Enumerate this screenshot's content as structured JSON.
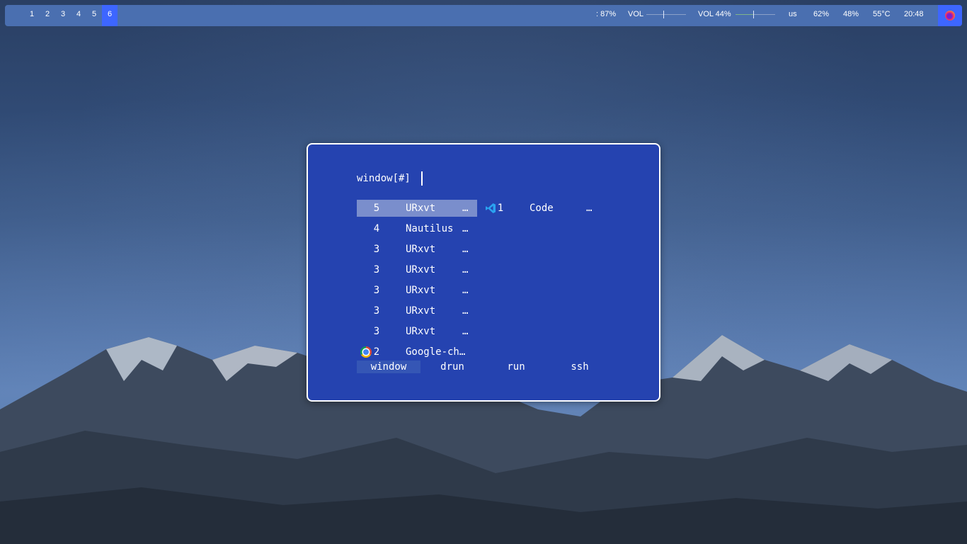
{
  "bar": {
    "workspaces": [
      "1",
      "2",
      "3",
      "4",
      "5",
      "6"
    ],
    "active_workspace": "6",
    "battery": ": 87%",
    "vol_a_label": "VOL",
    "vol_b_label": "VOL 44%",
    "vol_b_level": 0.44,
    "keyboard_layout": "us",
    "cpu": "62%",
    "memory": "48%",
    "temperature": "55°C",
    "clock": "20:48",
    "tray_icon": "firefox-icon"
  },
  "rofi": {
    "prompt": "window[#]",
    "entries_col1": [
      {
        "num": "5",
        "name": "URxvt",
        "ellipsis": "…",
        "icon": null,
        "selected": true
      },
      {
        "num": "4",
        "name": "Nautilus",
        "ellipsis": "…",
        "icon": null,
        "selected": false
      },
      {
        "num": "3",
        "name": "URxvt",
        "ellipsis": "…",
        "icon": null,
        "selected": false
      },
      {
        "num": "3",
        "name": "URxvt",
        "ellipsis": "…",
        "icon": null,
        "selected": false
      },
      {
        "num": "3",
        "name": "URxvt",
        "ellipsis": "…",
        "icon": null,
        "selected": false
      },
      {
        "num": "3",
        "name": "URxvt",
        "ellipsis": "…",
        "icon": null,
        "selected": false
      },
      {
        "num": "3",
        "name": "URxvt",
        "ellipsis": "…",
        "icon": null,
        "selected": false
      },
      {
        "num": "2",
        "name": "Google-ch…",
        "ellipsis": "",
        "icon": "chrome-icon",
        "selected": false
      }
    ],
    "entries_col2": [
      {
        "num": "1",
        "name": "Code",
        "ellipsis": "…",
        "icon": "vscode-icon",
        "selected": false
      }
    ],
    "modes": [
      "window",
      "drun",
      "run",
      "ssh"
    ],
    "active_mode": "window"
  },
  "colors": {
    "bar_bg": "#4a6fb0",
    "bar_active": "#3d66ff",
    "rofi_bg": "#2543b0",
    "rofi_selected": "#7a8ecc"
  }
}
